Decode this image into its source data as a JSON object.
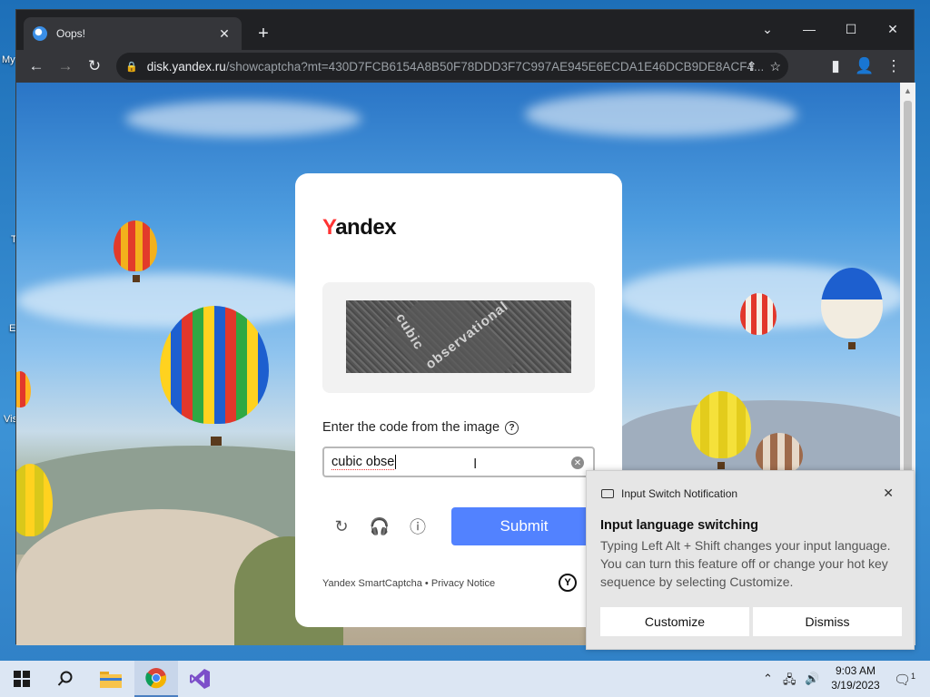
{
  "desktop": {
    "edge_labels": [
      "My",
      "T",
      "E",
      "Vis"
    ]
  },
  "browser": {
    "tab_title": "Oops!",
    "url_host": "disk.yandex.ru",
    "url_path": "/showcaptcha?mt=430D7FCB6154A8B50F78DDD3F7C997AE945E6ECDA1E46DCB9DE8ACF4..."
  },
  "captcha": {
    "logo_first": "Y",
    "logo_rest": "andex",
    "image_words": [
      "cubic",
      "observational"
    ],
    "instruction": "Enter the code from the image",
    "help_glyph": "?",
    "input_value": "cubic obse",
    "submit_label": "Submit",
    "footer_text": "Yandex SmartCaptcha • Privacy Notice",
    "badge_glyph": "Y"
  },
  "notification": {
    "app": "Input Switch Notification",
    "title": "Input language switching",
    "body": "Typing Left Alt + Shift changes your input language. You can turn this feature off or change your hot key sequence by selecting Customize.",
    "customize_label": "Customize",
    "dismiss_label": "Dismiss"
  },
  "taskbar": {
    "time": "9:03 AM",
    "date": "3/19/2023",
    "notification_count": "1"
  },
  "colors": {
    "submit": "#5282ff",
    "yandex_red": "#ff3333",
    "chrome_dark": "#202124"
  }
}
